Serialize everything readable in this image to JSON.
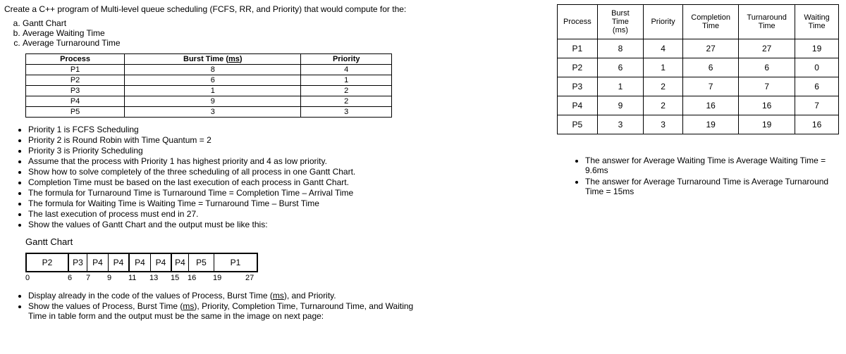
{
  "intro": "Create a C++ program of Multi-level queue scheduling (FCFS, RR, and Priority) that would compute for the:",
  "req_list": {
    "a": "Gantt Chart",
    "b": "Average Waiting Time",
    "c": "Average Turnaround Time"
  },
  "proc_headers": {
    "process": "Process",
    "burst": "Burst Time (",
    "burst_u": "ms",
    "burst2": ")",
    "priority": "Priority"
  },
  "proc_rows": [
    {
      "p": "P1",
      "b": "8",
      "pr": "4"
    },
    {
      "p": "P2",
      "b": "6",
      "pr": "1"
    },
    {
      "p": "P3",
      "b": "1",
      "pr": "2"
    },
    {
      "p": "P4",
      "b": "9",
      "pr": "2"
    },
    {
      "p": "P5",
      "b": "3",
      "pr": "3"
    }
  ],
  "bullets1": [
    "Priority 1 is FCFS Scheduling",
    "Priority 2 is Round Robin with Time Quantum = 2",
    "Priority 3 is Priority Scheduling",
    "Assume that the process with Priority 1 has highest priority and 4 as low priority.",
    "Show how to solve completely of the three scheduling of all process in one Gantt Chart.",
    "Completion Time must be based on the last execution of each process in Gantt Chart.",
    "The formula for Turnaround Time is Turnaround Time = Completion Time – Arrival Time",
    "The formula for Waiting Time is Waiting Time = Turnaround Time – Burst Time",
    "The last execution of process must end in 27.",
    "Show the values of Gantt Chart and the output must be like this:"
  ],
  "gantt_title": "Gantt Chart",
  "gantt_cells": [
    "P2",
    "P3",
    "P4",
    "P4",
    "P4",
    "P4",
    "P4",
    "P5",
    "P1"
  ],
  "gantt_ticks": [
    "0",
    "6",
    "7",
    "9",
    "11",
    "13",
    "15",
    "16",
    "19",
    "27"
  ],
  "bullets2a_pre": "Display already in the code of the values of Process, Burst Time (",
  "bullets2a_u": "ms",
  "bullets2a_post": "), and Priority.",
  "bullets2b_pre": "Show the values of Process, Burst Time (",
  "bullets2b_u": "ms",
  "bullets2b_post": "), Priority, Completion Time, Turnaround Time, and Waiting Time in table form and the output must be the same in the image on next page:",
  "res_headers": {
    "process": "Process",
    "burst": "Burst Time (ms)",
    "priority": "Priority",
    "completion": "Completion Time",
    "turnaround": "Turnaround Time",
    "waiting": "Waiting Time"
  },
  "res_rows": [
    {
      "p": "P1",
      "b": "8",
      "pr": "4",
      "c": "27",
      "t": "27",
      "w": "19"
    },
    {
      "p": "P2",
      "b": "6",
      "pr": "1",
      "c": "6",
      "t": "6",
      "w": "0"
    },
    {
      "p": "P3",
      "b": "1",
      "pr": "2",
      "c": "7",
      "t": "7",
      "w": "6"
    },
    {
      "p": "P4",
      "b": "9",
      "pr": "2",
      "c": "16",
      "t": "16",
      "w": "7"
    },
    {
      "p": "P5",
      "b": "3",
      "pr": "3",
      "c": "19",
      "t": "19",
      "w": "16"
    }
  ],
  "ans1": "The answer for Average Waiting Time is Average Waiting Time = 9.6ms",
  "ans2": "The answer for Average Turnaround Time is Average Turnaround Time = 15ms"
}
